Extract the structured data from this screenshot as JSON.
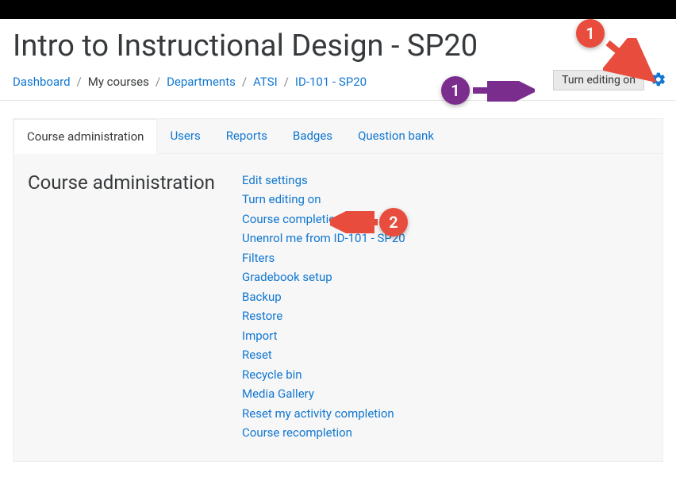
{
  "page": {
    "title": "Intro to Instructional Design - SP20"
  },
  "breadcrumb": {
    "items": [
      {
        "label": "Dashboard",
        "link": true
      },
      {
        "label": "My courses",
        "link": false
      },
      {
        "label": "Departments",
        "link": true
      },
      {
        "label": "ATSI",
        "link": true
      },
      {
        "label": "ID-101 - SP20",
        "link": true
      }
    ],
    "sep": "/"
  },
  "gear": {
    "tooltip": "Turn editing on"
  },
  "tabs": {
    "items": [
      {
        "label": "Course administration",
        "active": true
      },
      {
        "label": "Users",
        "active": false
      },
      {
        "label": "Reports",
        "active": false
      },
      {
        "label": "Badges",
        "active": false
      },
      {
        "label": "Question bank",
        "active": false
      }
    ]
  },
  "admin": {
    "heading": "Course administration",
    "links": [
      "Edit settings",
      "Turn editing on",
      "Course completion",
      "Unenrol me from ID-101 - SP20",
      "Filters",
      "Gradebook setup",
      "Backup",
      "Restore",
      "Import",
      "Reset",
      "Recycle bin",
      "Media Gallery",
      "Reset my activity completion",
      "Course recompletion"
    ]
  },
  "callouts": {
    "c1_red": "1",
    "c1_purple": "1",
    "c2_red": "2"
  },
  "colors": {
    "link": "#1177d1",
    "red": "#e74c3c",
    "purple": "#7b2d8e",
    "gear": "#1177d1"
  }
}
